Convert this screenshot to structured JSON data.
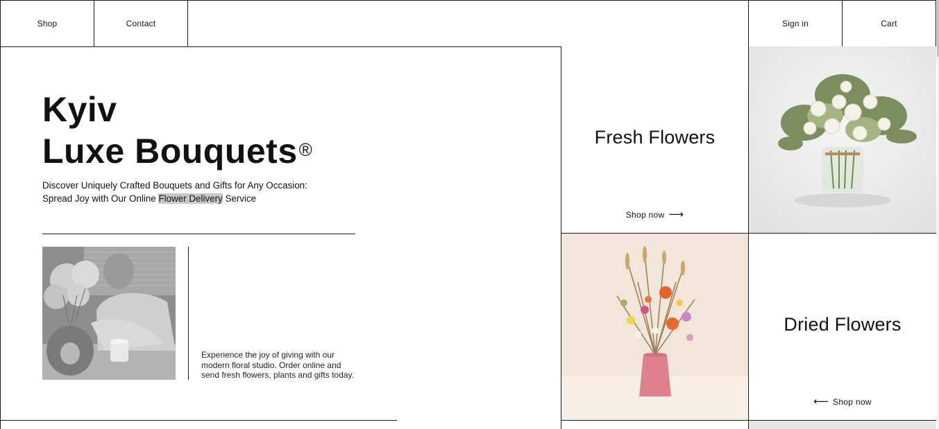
{
  "nav": {
    "shop": "Shop",
    "contact": "Contact",
    "sign_in": "Sign in",
    "cart": "Cart"
  },
  "hero": {
    "title_line1": "Kyiv",
    "title_line2": "Luxe Bouquets",
    "registered_mark": "®",
    "subtitle_line1": "Discover Uniquely Crafted Bouquets and Gifts for Any Occasion:",
    "subtitle_line2_prefix": "Spread Joy with Our Online ",
    "subtitle_highlight": "Flower Delivery",
    "subtitle_line2_suffix": " Service",
    "photo_alt": "woman-with-flowers-photo",
    "about_text": "Experience the joy of giving with our modern floral studio. Order online and send fresh flowers, plants and gifts today."
  },
  "tiles": {
    "fresh": {
      "title": "Fresh Flowers",
      "link": "Shop now",
      "arrow": "⟶"
    },
    "dried": {
      "title": "Dried Flowers",
      "link": "Shop now",
      "arrow": "⟵"
    }
  },
  "colors": {
    "text": "#111111",
    "border": "#1a1a1a",
    "highlight": "#c8c8c8",
    "fresh_photo_bg": "#ececec",
    "dried_photo_bg": "#f2e6db"
  }
}
